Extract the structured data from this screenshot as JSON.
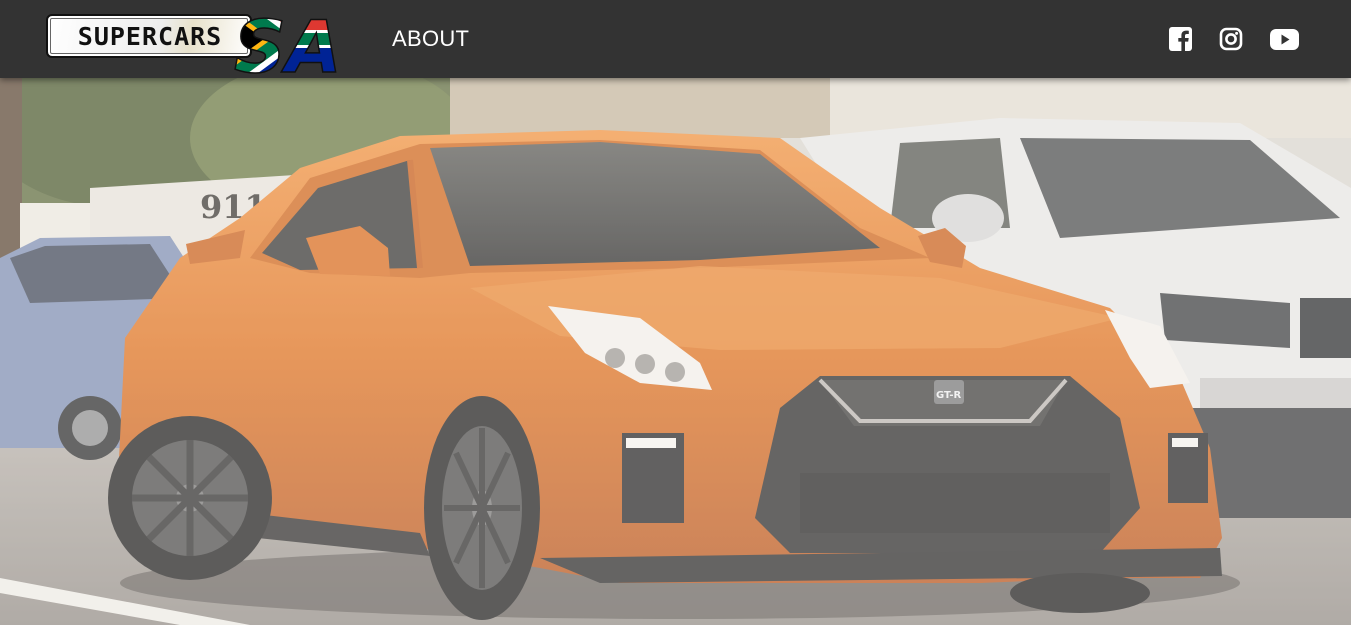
{
  "navbar": {
    "logo": {
      "plate_text": "SUPERCARS",
      "mark_text": "SA",
      "flag_colors": [
        "#007a4d",
        "#ffb612",
        "#000000",
        "#de3831",
        "#002395",
        "#ffffff"
      ]
    },
    "links": [
      {
        "label": "ABOUT"
      }
    ],
    "social": [
      {
        "icon": "facebook-icon"
      },
      {
        "icon": "instagram-icon"
      },
      {
        "icon": "youtube-icon"
      }
    ]
  },
  "hero": {
    "image_label": "911",
    "badge_text": "GT-R",
    "colors": {
      "car_orange": "#dd6f1c",
      "navbar_bg": "#333333"
    }
  }
}
